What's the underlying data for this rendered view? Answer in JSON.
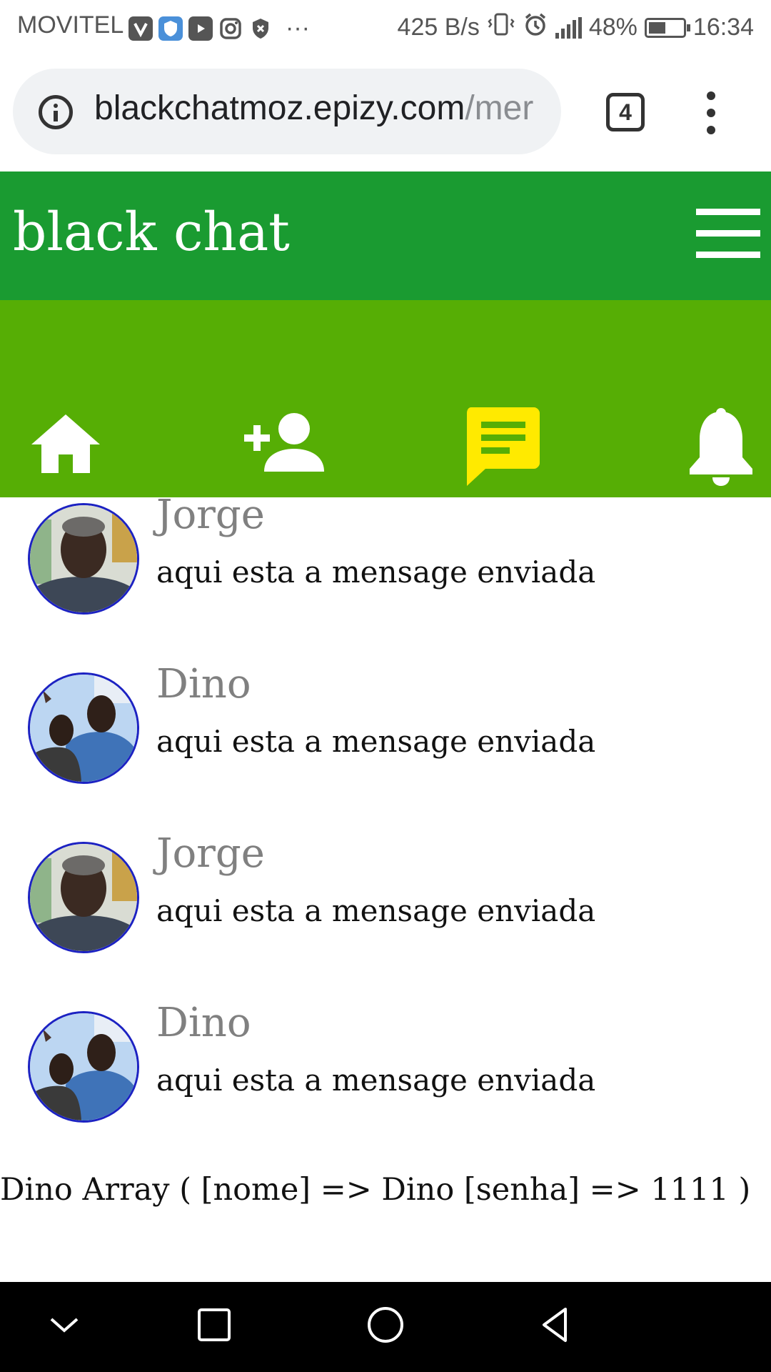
{
  "status_bar": {
    "carrier": "MOVITEL",
    "more_notifications": "···",
    "network_speed": "425 B/s",
    "battery_percent": "48%",
    "time": "16:34"
  },
  "browser": {
    "url_host": "blackchatmoz.epizy.com",
    "url_path": "/mer",
    "tab_count": "4"
  },
  "app": {
    "title": "black chat",
    "accent_color": "#1a9b31",
    "nav_color": "#56ae05",
    "active_tab_color": "#ffea00",
    "nav": [
      {
        "icon": "home-icon"
      },
      {
        "icon": "add-person-icon"
      },
      {
        "icon": "chat-icon",
        "active": true
      },
      {
        "icon": "bell-icon"
      }
    ]
  },
  "chats": [
    {
      "name": "Jorge",
      "message": "aqui esta a mensage enviada",
      "avatar": "avatar-jorge"
    },
    {
      "name": "Dino",
      "message": "aqui esta a mensage enviada",
      "avatar": "avatar-dino"
    },
    {
      "name": "Jorge",
      "message": "aqui esta a mensage enviada",
      "avatar": "avatar-jorge"
    },
    {
      "name": "Dino",
      "message": "aqui esta a mensage enviada",
      "avatar": "avatar-dino"
    }
  ],
  "debug_output": "Dino Array ( [nome] => Dino [senha] => 1111 )"
}
